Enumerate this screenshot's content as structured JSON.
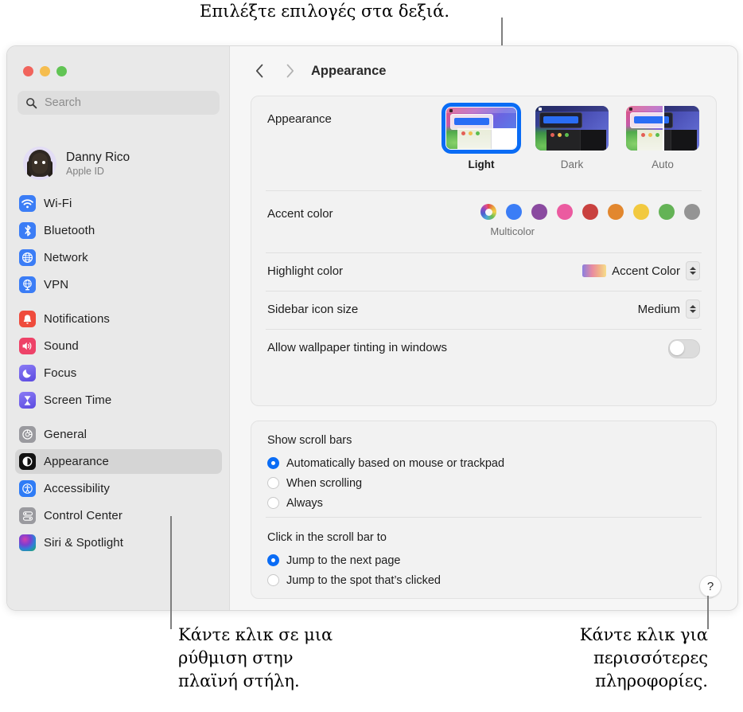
{
  "callouts": {
    "top": "Επιλέξτε επιλογές στα δεξιά.",
    "bottom_left": "Κάντε κλικ σε μια\nρύθμιση στην\nπλαϊνή στήλη.",
    "bottom_right": "Κάντε κλικ για\nπερισσότερες\nπληροφορίες."
  },
  "window": {
    "title": "Appearance",
    "back_icon": "chevron-left-icon",
    "forward_icon": "chevron-right-icon",
    "help_label": "?"
  },
  "sidebar": {
    "search": {
      "placeholder": "Search",
      "value": "",
      "icon": "search-icon"
    },
    "account": {
      "name": "Danny Rico",
      "subtitle": "Apple ID",
      "avatar": "memoji-avatar"
    },
    "groups": [
      {
        "items": [
          {
            "label": "Wi-Fi",
            "icon": "wifi-icon",
            "color": "#3b7df6",
            "selected": false
          },
          {
            "label": "Bluetooth",
            "icon": "bluetooth-icon",
            "color": "#3b7df6",
            "selected": false
          },
          {
            "label": "Network",
            "icon": "globe-icon",
            "color": "#3b7df6",
            "selected": false
          },
          {
            "label": "VPN",
            "icon": "vpn-globe-icon",
            "color": "#3b7df6",
            "selected": false
          }
        ]
      },
      {
        "items": [
          {
            "label": "Notifications",
            "icon": "bell-icon",
            "color": "#ef4b3c",
            "selected": false
          },
          {
            "label": "Sound",
            "icon": "speaker-icon",
            "color": "#ee4268",
            "selected": false
          },
          {
            "label": "Focus",
            "icon": "moon-icon",
            "color": "#6a5cf0",
            "selected": false
          },
          {
            "label": "Screen Time",
            "icon": "hourglass-icon",
            "color": "#6a5cf0",
            "selected": false
          }
        ]
      },
      {
        "items": [
          {
            "label": "General",
            "icon": "gear-icon",
            "color": "#8e8e93",
            "selected": false
          },
          {
            "label": "Appearance",
            "icon": "appearance-icon",
            "color": "#111111",
            "selected": true
          },
          {
            "label": "Accessibility",
            "icon": "accessibility-icon",
            "color": "#2f7cf6",
            "selected": false
          },
          {
            "label": "Control Center",
            "icon": "control-center-icon",
            "color": "#8e8e93",
            "selected": false
          },
          {
            "label": "Siri & Spotlight",
            "icon": "siri-icon",
            "color": "#2a2a3a",
            "selected": false
          }
        ]
      }
    ]
  },
  "main": {
    "appearance": {
      "label": "Appearance",
      "themes": [
        {
          "name": "Light",
          "selected": true
        },
        {
          "name": "Dark",
          "selected": false
        },
        {
          "name": "Auto",
          "selected": false
        }
      ]
    },
    "accent": {
      "label": "Accent color",
      "caption": "Multicolor",
      "swatches": [
        {
          "name": "Multicolor",
          "color": "multicolor",
          "selected": true
        },
        {
          "name": "Blue",
          "color": "#3b7df6"
        },
        {
          "name": "Purple",
          "color": "#8a4aa0"
        },
        {
          "name": "Pink",
          "color": "#eb5ba0"
        },
        {
          "name": "Red",
          "color": "#c9413f"
        },
        {
          "name": "Orange",
          "color": "#e2872e"
        },
        {
          "name": "Yellow",
          "color": "#f2c93f"
        },
        {
          "name": "Green",
          "color": "#64b356"
        },
        {
          "name": "Graphite",
          "color": "#949494"
        }
      ]
    },
    "highlight_color": {
      "label": "Highlight color",
      "value": "Accent Color",
      "chip": "accent-gradient-chip"
    },
    "sidebar_icon_size": {
      "label": "Sidebar icon size",
      "value": "Medium"
    },
    "wallpaper_tinting": {
      "label": "Allow wallpaper tinting in windows",
      "enabled": false
    },
    "show_scroll_bars": {
      "label": "Show scroll bars",
      "options": [
        {
          "label": "Automatically based on mouse or trackpad",
          "selected": true
        },
        {
          "label": "When scrolling",
          "selected": false
        },
        {
          "label": "Always",
          "selected": false
        }
      ]
    },
    "click_scroll_bar": {
      "label": "Click in the scroll bar to",
      "options": [
        {
          "label": "Jump to the next page",
          "selected": true
        },
        {
          "label": "Jump to the spot that’s clicked",
          "selected": false
        }
      ]
    }
  }
}
